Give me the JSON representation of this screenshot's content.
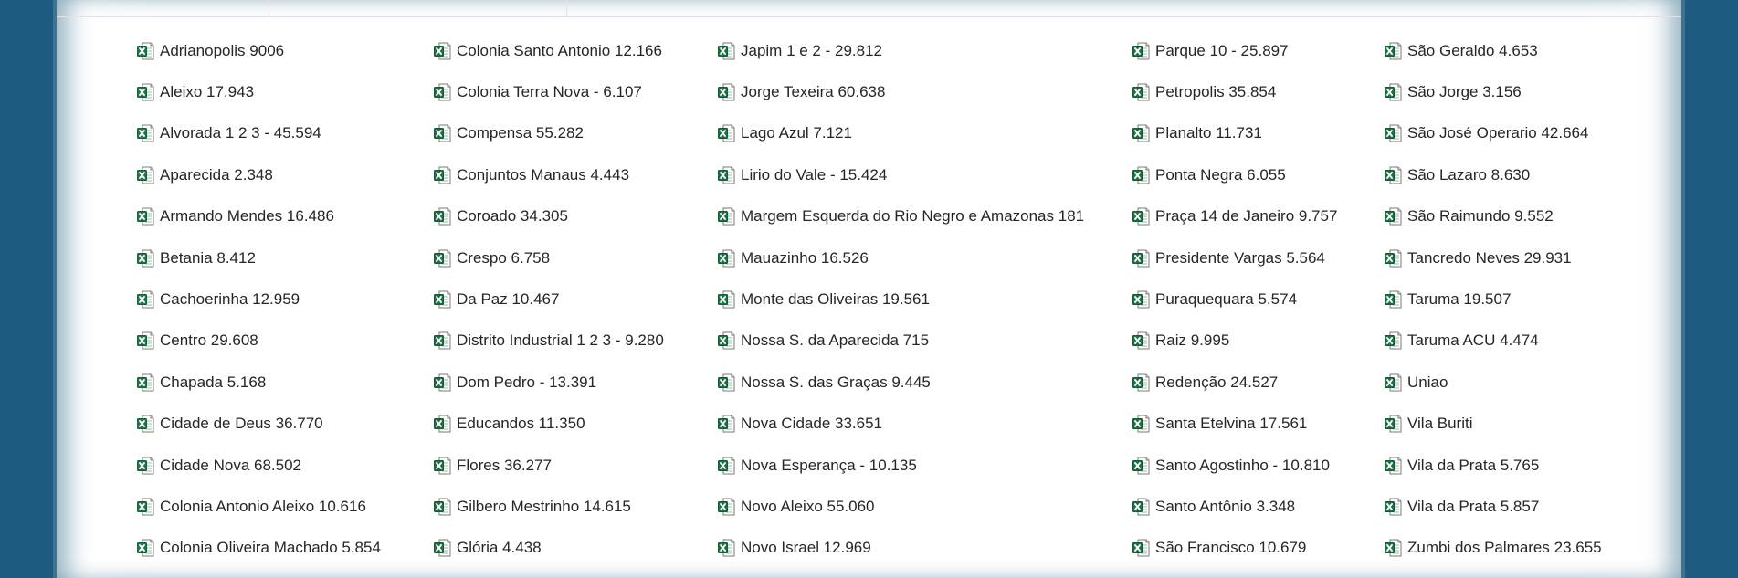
{
  "colors": {
    "background": "#1d5c80",
    "panel": "#ffffff",
    "text": "#262626",
    "excel_green": "#1e7145"
  },
  "icon": "excel-file-icon",
  "columns": [
    {
      "items": [
        "Adrianopolis 9006",
        "Aleixo 17.943",
        "Alvorada 1 2 3 - 45.594",
        "Aparecida 2.348",
        "Armando Mendes 16.486",
        "Betania 8.412",
        "Cachoerinha 12.959",
        "Centro 29.608",
        "Chapada 5.168",
        "Cidade de Deus 36.770",
        "Cidade Nova 68.502",
        "Colonia Antonio Aleixo 10.616",
        "Colonia Oliveira Machado 5.854"
      ]
    },
    {
      "items": [
        "Colonia Santo Antonio 12.166",
        "Colonia Terra Nova - 6.107",
        "Compensa 55.282",
        "Conjuntos Manaus 4.443",
        "Coroado 34.305",
        "Crespo 6.758",
        "Da Paz 10.467",
        "Distrito Industrial 1 2 3 - 9.280",
        "Dom Pedro - 13.391",
        "Educandos 11.350",
        "Flores 36.277",
        "Gilbero Mestrinho 14.615",
        "Glória 4.438"
      ]
    },
    {
      "items": [
        "Japim 1 e 2 - 29.812",
        "Jorge Texeira 60.638",
        "Lago Azul 7.121",
        "Lirio do Vale - 15.424",
        "Margem Esquerda do Rio Negro e Amazonas 181",
        "Mauazinho 16.526",
        "Monte das Oliveiras 19.561",
        "Nossa S. da Aparecida 715",
        "Nossa S. das Graças 9.445",
        "Nova Cidade 33.651",
        "Nova Esperança - 10.135",
        "Novo Aleixo 55.060",
        "Novo Israel 12.969"
      ]
    },
    {
      "items": [
        "Parque 10 - 25.897",
        "Petropolis 35.854",
        "Planalto 11.731",
        "Ponta Negra 6.055",
        "Praça 14 de Janeiro 9.757",
        "Presidente Vargas 5.564",
        "Puraquequara 5.574",
        "Raiz 9.995",
        "Redenção 24.527",
        "Santa Etelvina 17.561",
        "Santo Agostinho - 10.810",
        "Santo Antônio 3.348",
        "São Francisco 10.679"
      ]
    },
    {
      "items": [
        "São Geraldo 4.653",
        "São Jorge 3.156",
        "São José Operario 42.664",
        "São Lazaro 8.630",
        "São Raimundo 9.552",
        "Tancredo Neves 29.931",
        "Taruma 19.507",
        "Taruma ACU 4.474",
        "Uniao",
        "Vila Buriti",
        "Vila da Prata 5.765",
        "Vila da Prata 5.857",
        "Zumbi dos Palmares 23.655"
      ]
    }
  ]
}
